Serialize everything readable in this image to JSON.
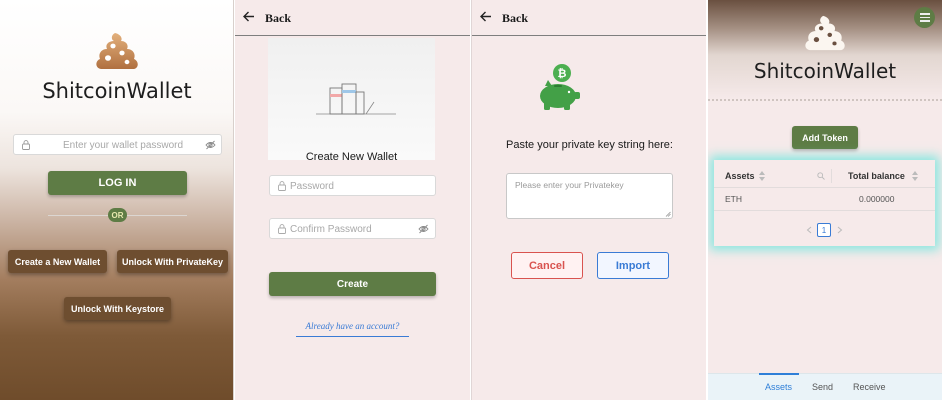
{
  "brand": {
    "app_name": "ShitcoinWallet"
  },
  "login": {
    "password_placeholder": "Enter your wallet password",
    "login_label": "LOG IN",
    "or_label": "OR",
    "create_wallet_label": "Create a New Wallet",
    "unlock_privatekey_label": "Unlock With PrivateKey",
    "unlock_keystore_label": "Unlock With Keystore"
  },
  "create": {
    "back_label": "Back",
    "title": "Create New Wallet",
    "password_placeholder": "Password",
    "confirm_placeholder": "Confirm Password",
    "create_label": "Create",
    "have_account_label": "Already have an account?"
  },
  "import": {
    "back_label": "Back",
    "prompt": "Paste your private key string here:",
    "privatekey_placeholder": "Please enter your Privatekey",
    "cancel_label": "Cancel",
    "import_label": "Import"
  },
  "dashboard": {
    "add_token_label": "Add Token",
    "table": {
      "headers": [
        "Assets",
        "Total balance"
      ],
      "rows": [
        {
          "asset": "ETH",
          "balance": "0.000000"
        }
      ]
    },
    "pagination": {
      "current_page": "1"
    },
    "tabs": [
      "Assets",
      "Send",
      "Receive"
    ],
    "active_tab": "Assets"
  },
  "colors": {
    "accent_green": "#5e7c45",
    "brown": "#6e4e30",
    "pink_bg": "#f6eaea",
    "cancel_red": "#d9534f",
    "import_blue": "#3a7bd5",
    "tab_blue": "#2f7fd8"
  }
}
